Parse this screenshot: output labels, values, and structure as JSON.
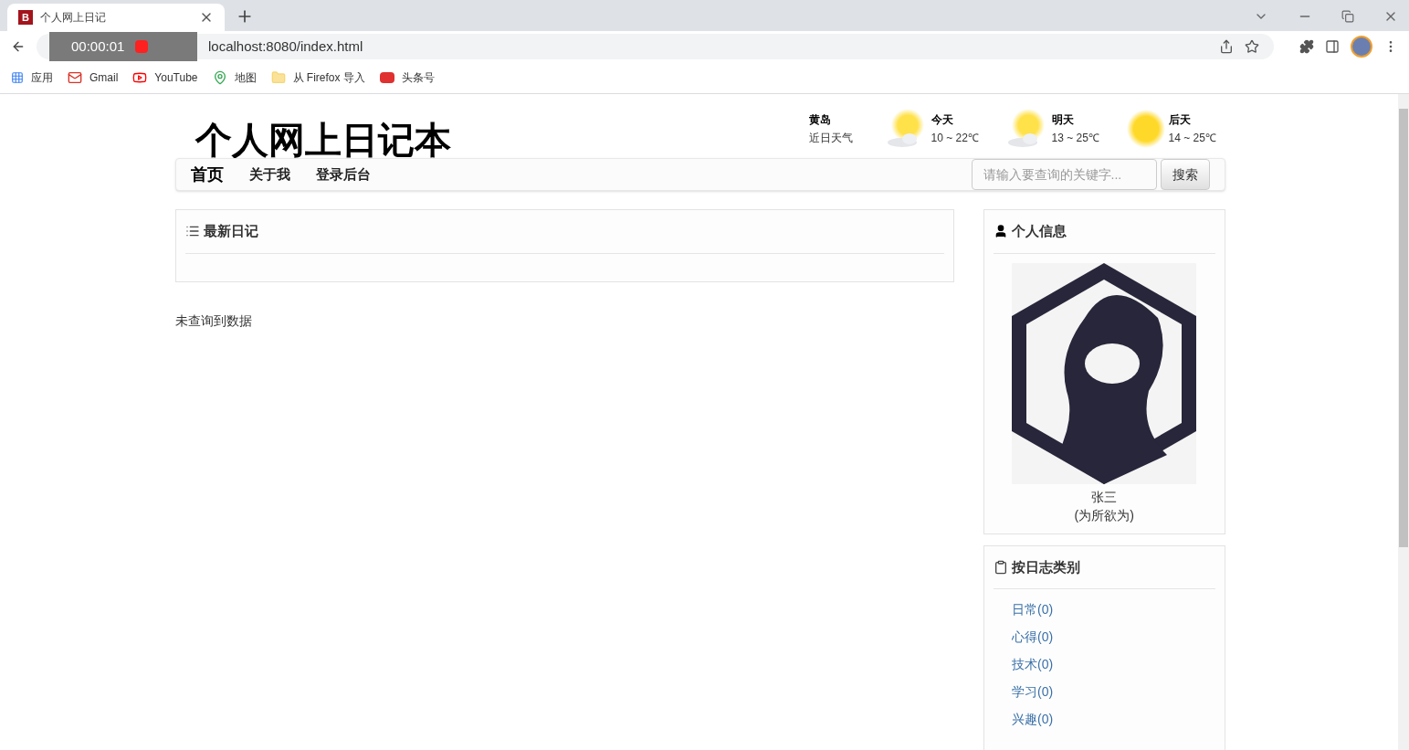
{
  "browser": {
    "tab": {
      "favicon": "B",
      "title": "个人网上日记"
    },
    "recorder": {
      "time": "00:00:01"
    },
    "url": "localhost:8080/index.html",
    "bookmarks": [
      {
        "kind": "apps",
        "label": "应用"
      },
      {
        "kind": "gmail",
        "label": "Gmail"
      },
      {
        "kind": "youtube",
        "label": "YouTube"
      },
      {
        "kind": "maps",
        "label": "地图"
      },
      {
        "kind": "folder",
        "label": "从 Firefox 导入"
      },
      {
        "kind": "news",
        "label": "头条号"
      }
    ]
  },
  "site": {
    "title": "个人网上日记本",
    "weather": {
      "city": "黄岛",
      "caption": "近日天气",
      "days": [
        {
          "label": "今天",
          "range": "10 ~ 22℃",
          "kind": "cloudy"
        },
        {
          "label": "明天",
          "range": "13 ~ 25℃",
          "kind": "cloudy"
        },
        {
          "label": "后天",
          "range": "14 ~ 25℃",
          "kind": "sunny"
        }
      ]
    },
    "nav": [
      {
        "label": "首页",
        "selected": true
      },
      {
        "label": "关于我",
        "selected": false
      },
      {
        "label": "登录后台",
        "selected": false
      }
    ],
    "search": {
      "placeholder": "请输入要查询的关键字...",
      "button": "搜索"
    },
    "latest": {
      "title": "最新日记"
    },
    "empty": "未查询到数据",
    "profile": {
      "title": "个人信息",
      "name": "张三",
      "motto": "(为所欲为)"
    },
    "categories": {
      "title": "按日志类别",
      "items": [
        {
          "label": "日常(0)"
        },
        {
          "label": "心得(0)"
        },
        {
          "label": "技术(0)"
        },
        {
          "label": "学习(0)"
        },
        {
          "label": "兴趣(0)"
        }
      ]
    }
  }
}
